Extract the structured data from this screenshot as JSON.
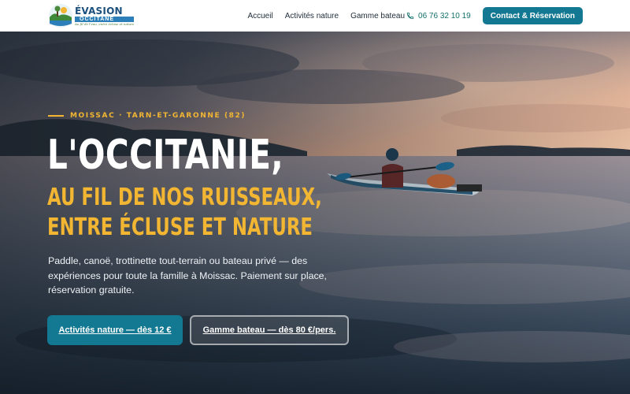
{
  "header": {
    "logo": {
      "main": "ÉVASION",
      "sub": "OCCITANE",
      "tagline": "Au fil de l'eau, entre écluse et nature"
    },
    "nav": [
      {
        "label": "Accueil"
      },
      {
        "label": "Activités nature"
      },
      {
        "label": "Gamme bateau"
      }
    ],
    "phone": "06 76 32 10 19",
    "cta": "Contact & Réservation"
  },
  "hero": {
    "eyebrow": "MOISSAC · TARN-ET-GARONNE (82)",
    "title": "L'OCCITANIE,",
    "subtitle_line1": "AU FIL DE NOS RUISSEAUX,",
    "subtitle_line2": "ENTRE ÉCLUSE ET NATURE",
    "description": "Paddle, canoë, trottinette tout-terrain ou bateau privé — des expériences pour toute la famille à Moissac. Paiement sur place, réservation gratuite.",
    "primary_button": "Activités nature — dès 12 €",
    "secondary_button": "Gamme bateau — dès 80 €/pers."
  },
  "colors": {
    "accent": "#137891",
    "highlight": "#f2b632",
    "phone": "#15706c"
  },
  "icons": {
    "logo": "kayaker-logo-icon",
    "phone": "phone-icon"
  }
}
